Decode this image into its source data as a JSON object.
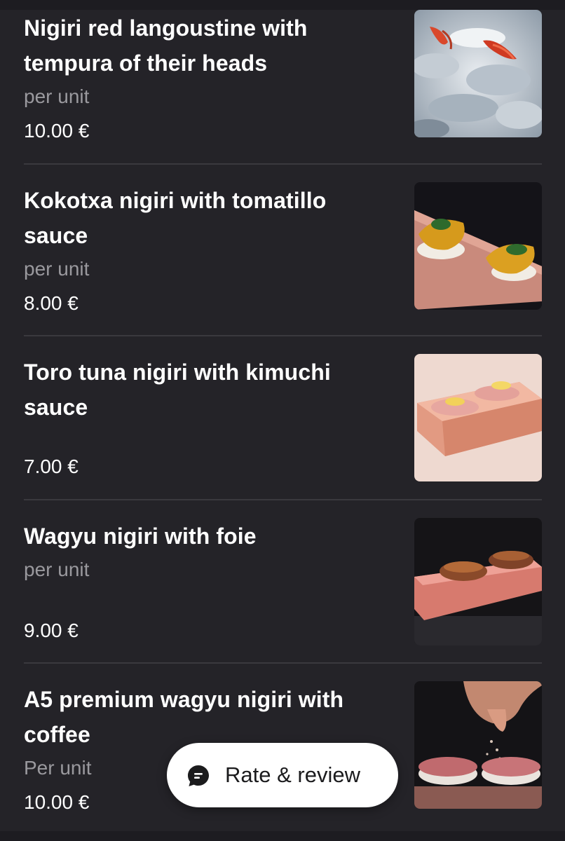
{
  "menu": {
    "items": [
      {
        "name": "Nigiri red langoustine with tempura of their heads",
        "unit": "per unit",
        "price": "10.00 €",
        "image": "langoustine-nigiri-photo"
      },
      {
        "name": "Kokotxa nigiri with tomatillo sauce",
        "unit": "per unit",
        "price": "8.00 €",
        "image": "kokotxa-nigiri-photo"
      },
      {
        "name": "Toro tuna nigiri with kimuchi sauce",
        "unit": "",
        "price": "7.00 €",
        "image": "toro-tuna-nigiri-photo"
      },
      {
        "name": "Wagyu nigiri with foie",
        "unit": "per unit",
        "price": "9.00 €",
        "image": "wagyu-foie-nigiri-photo"
      },
      {
        "name": "A5 premium wagyu nigiri with coffee",
        "unit": "Per unit",
        "price": "10.00 €",
        "image": "a5-wagyu-coffee-nigiri-photo"
      }
    ]
  },
  "review_button": {
    "label": "Rate & review",
    "icon": "chat-bubble-icon"
  },
  "colors": {
    "background": "#242328",
    "text": "#ffffff",
    "secondary_text": "#9a999e",
    "divider": "#3a393e",
    "button_bg": "#ffffff"
  }
}
